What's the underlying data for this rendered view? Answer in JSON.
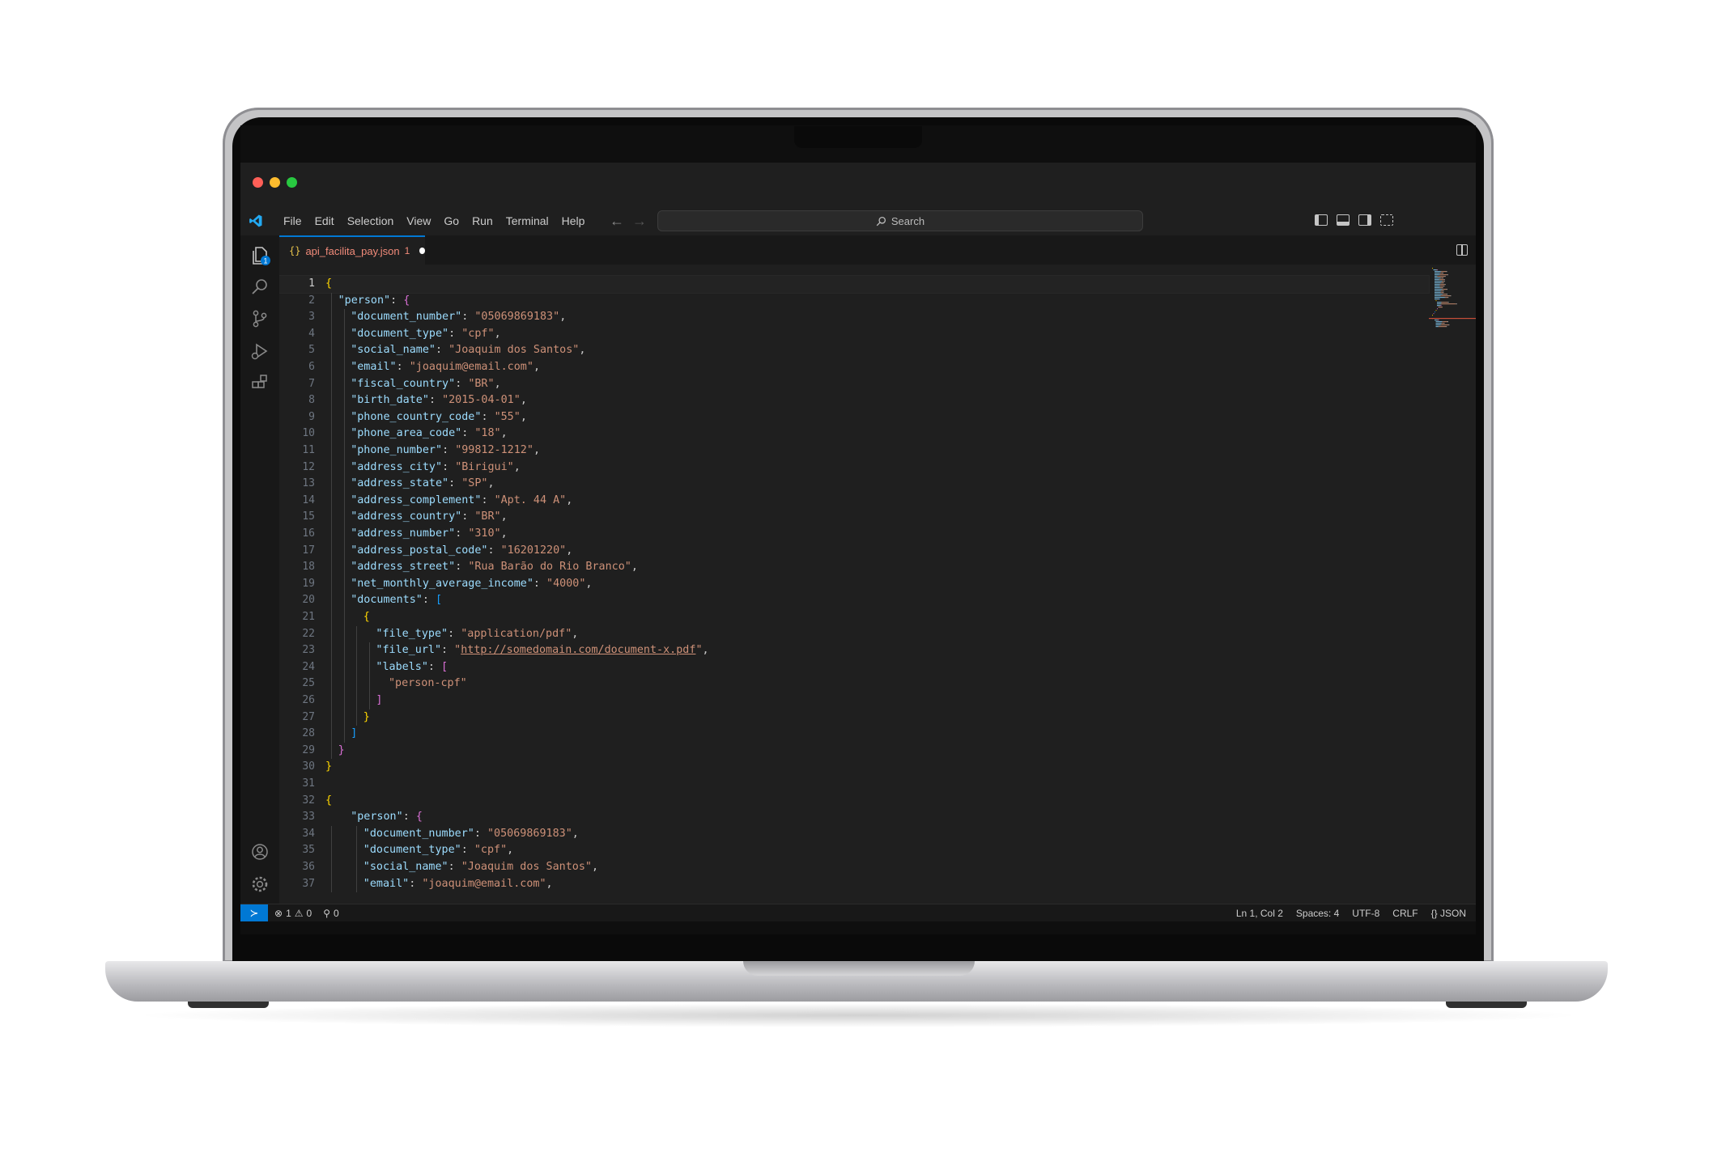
{
  "window": {
    "menu": [
      "File",
      "Edit",
      "Selection",
      "View",
      "Go",
      "Run",
      "Terminal",
      "Help"
    ],
    "search_label": "Search"
  },
  "activity_bar": {
    "explorer_badge": "1"
  },
  "tab": {
    "icon": "{}",
    "label": "api_facilita_pay.json",
    "problem_count": "1",
    "label_color": "#f28b7a",
    "modified": true
  },
  "editor": {
    "current_line": 1,
    "lines": [
      {
        "n": "1",
        "i": 0,
        "t": [
          [
            "b1",
            "{"
          ]
        ]
      },
      {
        "n": "2",
        "i": 1,
        "t": [
          [
            "k",
            "\"person\""
          ],
          [
            "p",
            ": "
          ],
          [
            "b2",
            "{"
          ]
        ]
      },
      {
        "n": "3",
        "i": 2,
        "t": [
          [
            "k",
            "\"document_number\""
          ],
          [
            "p",
            ": "
          ],
          [
            "s",
            "\"05069869183\""
          ],
          [
            "p",
            ","
          ]
        ]
      },
      {
        "n": "4",
        "i": 2,
        "t": [
          [
            "k",
            "\"document_type\""
          ],
          [
            "p",
            ": "
          ],
          [
            "s",
            "\"cpf\""
          ],
          [
            "p",
            ","
          ]
        ]
      },
      {
        "n": "5",
        "i": 2,
        "t": [
          [
            "k",
            "\"social_name\""
          ],
          [
            "p",
            ": "
          ],
          [
            "s",
            "\"Joaquim dos Santos\""
          ],
          [
            "p",
            ","
          ]
        ]
      },
      {
        "n": "6",
        "i": 2,
        "t": [
          [
            "k",
            "\"email\""
          ],
          [
            "p",
            ": "
          ],
          [
            "s",
            "\"joaquim@email.com\""
          ],
          [
            "p",
            ","
          ]
        ]
      },
      {
        "n": "7",
        "i": 2,
        "t": [
          [
            "k",
            "\"fiscal_country\""
          ],
          [
            "p",
            ": "
          ],
          [
            "s",
            "\"BR\""
          ],
          [
            "p",
            ","
          ]
        ]
      },
      {
        "n": "8",
        "i": 2,
        "t": [
          [
            "k",
            "\"birth_date\""
          ],
          [
            "p",
            ": "
          ],
          [
            "s",
            "\"2015-04-01\""
          ],
          [
            "p",
            ","
          ]
        ]
      },
      {
        "n": "9",
        "i": 2,
        "t": [
          [
            "k",
            "\"phone_country_code\""
          ],
          [
            "p",
            ": "
          ],
          [
            "s",
            "\"55\""
          ],
          [
            "p",
            ","
          ]
        ]
      },
      {
        "n": "10",
        "i": 2,
        "t": [
          [
            "k",
            "\"phone_area_code\""
          ],
          [
            "p",
            ": "
          ],
          [
            "s",
            "\"18\""
          ],
          [
            "p",
            ","
          ]
        ]
      },
      {
        "n": "11",
        "i": 2,
        "t": [
          [
            "k",
            "\"phone_number\""
          ],
          [
            "p",
            ": "
          ],
          [
            "s",
            "\"99812-1212\""
          ],
          [
            "p",
            ","
          ]
        ]
      },
      {
        "n": "12",
        "i": 2,
        "t": [
          [
            "k",
            "\"address_city\""
          ],
          [
            "p",
            ": "
          ],
          [
            "s",
            "\"Birigui\""
          ],
          [
            "p",
            ","
          ]
        ]
      },
      {
        "n": "13",
        "i": 2,
        "t": [
          [
            "k",
            "\"address_state\""
          ],
          [
            "p",
            ": "
          ],
          [
            "s",
            "\"SP\""
          ],
          [
            "p",
            ","
          ]
        ]
      },
      {
        "n": "14",
        "i": 2,
        "t": [
          [
            "k",
            "\"address_complement\""
          ],
          [
            "p",
            ": "
          ],
          [
            "s",
            "\"Apt. 44 A\""
          ],
          [
            "p",
            ","
          ]
        ]
      },
      {
        "n": "15",
        "i": 2,
        "t": [
          [
            "k",
            "\"address_country\""
          ],
          [
            "p",
            ": "
          ],
          [
            "s",
            "\"BR\""
          ],
          [
            "p",
            ","
          ]
        ]
      },
      {
        "n": "16",
        "i": 2,
        "t": [
          [
            "k",
            "\"address_number\""
          ],
          [
            "p",
            ": "
          ],
          [
            "s",
            "\"310\""
          ],
          [
            "p",
            ","
          ]
        ]
      },
      {
        "n": "17",
        "i": 2,
        "t": [
          [
            "k",
            "\"address_postal_code\""
          ],
          [
            "p",
            ": "
          ],
          [
            "s",
            "\"16201220\""
          ],
          [
            "p",
            ","
          ]
        ]
      },
      {
        "n": "18",
        "i": 2,
        "t": [
          [
            "k",
            "\"address_street\""
          ],
          [
            "p",
            ": "
          ],
          [
            "s",
            "\"Rua Barão do Rio Branco\""
          ],
          [
            "p",
            ","
          ]
        ]
      },
      {
        "n": "19",
        "i": 2,
        "t": [
          [
            "k",
            "\"net_monthly_average_income\""
          ],
          [
            "p",
            ": "
          ],
          [
            "s",
            "\"4000\""
          ],
          [
            "p",
            ","
          ]
        ]
      },
      {
        "n": "20",
        "i": 2,
        "t": [
          [
            "k",
            "\"documents\""
          ],
          [
            "p",
            ": "
          ],
          [
            "b3",
            "["
          ]
        ]
      },
      {
        "n": "21",
        "i": 3,
        "t": [
          [
            "b1",
            "{"
          ]
        ]
      },
      {
        "n": "22",
        "i": 4,
        "t": [
          [
            "k",
            "\"file_type\""
          ],
          [
            "p",
            ": "
          ],
          [
            "s",
            "\"application/pdf\""
          ],
          [
            "p",
            ","
          ]
        ]
      },
      {
        "n": "23",
        "i": 4,
        "t": [
          [
            "k",
            "\"file_url\""
          ],
          [
            "p",
            ": "
          ],
          [
            "s",
            "\""
          ],
          [
            "su",
            "http://somedomain.com/document-x.pdf"
          ],
          [
            "s",
            "\""
          ],
          [
            "p",
            ","
          ]
        ]
      },
      {
        "n": "24",
        "i": 4,
        "t": [
          [
            "k",
            "\"labels\""
          ],
          [
            "p",
            ": "
          ],
          [
            "b2",
            "["
          ]
        ]
      },
      {
        "n": "25",
        "i": 5,
        "t": [
          [
            "s",
            "\"person-cpf\""
          ]
        ]
      },
      {
        "n": "26",
        "i": 4,
        "t": [
          [
            "b2",
            "]"
          ]
        ]
      },
      {
        "n": "27",
        "i": 3,
        "t": [
          [
            "b1",
            "}"
          ]
        ]
      },
      {
        "n": "28",
        "i": 2,
        "t": [
          [
            "b3",
            "]"
          ]
        ]
      },
      {
        "n": "29",
        "i": 1,
        "t": [
          [
            "b2",
            "}"
          ]
        ]
      },
      {
        "n": "30",
        "i": 0,
        "t": [
          [
            "b1",
            "}"
          ]
        ]
      },
      {
        "n": "31",
        "i": 0,
        "t": []
      },
      {
        "n": "32",
        "i": 0,
        "t": [
          [
            "b1",
            "{"
          ]
        ]
      },
      {
        "n": "33",
        "i": 2,
        "t": [
          [
            "k",
            "\"person\""
          ],
          [
            "p",
            ": "
          ],
          [
            "b2",
            "{"
          ]
        ]
      },
      {
        "n": "34",
        "i": 3,
        "t": [
          [
            "k",
            "\"document_number\""
          ],
          [
            "p",
            ": "
          ],
          [
            "s",
            "\"05069869183\""
          ],
          [
            "p",
            ","
          ]
        ]
      },
      {
        "n": "35",
        "i": 3,
        "t": [
          [
            "k",
            "\"document_type\""
          ],
          [
            "p",
            ": "
          ],
          [
            "s",
            "\"cpf\""
          ],
          [
            "p",
            ","
          ]
        ]
      },
      {
        "n": "36",
        "i": 3,
        "t": [
          [
            "k",
            "\"social_name\""
          ],
          [
            "p",
            ": "
          ],
          [
            "s",
            "\"Joaquim dos Santos\""
          ],
          [
            "p",
            ","
          ]
        ]
      },
      {
        "n": "37",
        "i": 3,
        "t": [
          [
            "k",
            "\"email\""
          ],
          [
            "p",
            ": "
          ],
          [
            "s",
            "\"joaquim@email.com\""
          ],
          [
            "p",
            ","
          ]
        ]
      }
    ]
  },
  "status_bar": {
    "remote_icon": "remote-icon",
    "errors": "1",
    "warnings": "0",
    "ports": "0",
    "position": "Ln 1, Col 2",
    "spaces": "Spaces: 4",
    "encoding": "UTF-8",
    "eol": "CRLF",
    "language": "JSON",
    "accent": "#0078d4"
  }
}
